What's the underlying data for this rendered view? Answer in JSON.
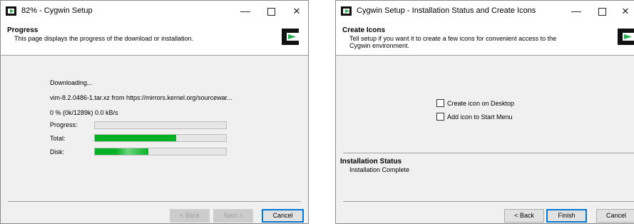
{
  "window1": {
    "title": "82% - Cygwin Setup",
    "controls": {
      "minimize": "—",
      "close": "✕"
    },
    "header": {
      "title": "Progress",
      "description": "This page displays the progress of the download or installation."
    },
    "status": "Downloading...",
    "file_line": "vim-8.2.0486-1.tar.xz from https://mirrors.kernel.org/sourcewar...",
    "speed": "0 %  (0k/1289k)  0.0 kB/s",
    "progress_rows": [
      {
        "label": "Progress:",
        "value": 0
      },
      {
        "label": "Total:",
        "value": 0.62
      },
      {
        "label": "Disk:",
        "value": 0.41
      }
    ],
    "buttons": {
      "back": "< Back",
      "next": "Next >",
      "cancel": "Cancel"
    }
  },
  "window2": {
    "title": "Cygwin Setup - Installation Status and Create Icons",
    "controls": {
      "minimize": "—",
      "close": "✕"
    },
    "header": {
      "title": "Create Icons",
      "description": "Tell setup if you want it to create a few icons for convenient access to the Cygwin environment."
    },
    "checkboxes": [
      {
        "label": "Create icon on Desktop",
        "checked": false
      },
      {
        "label": "Add icon to Start Menu",
        "checked": false
      }
    ],
    "status": {
      "title": "Installation Status",
      "text": "Installation Complete"
    },
    "buttons": {
      "back": "< Back",
      "finish": "Finish",
      "cancel": "Cancel"
    }
  },
  "colors": {
    "progress_fill": "#06b025",
    "default_button_border": "#0078d7"
  },
  "icons": {
    "app": "cygwin-icon",
    "header_logo": "cygwin-logo-icon"
  }
}
